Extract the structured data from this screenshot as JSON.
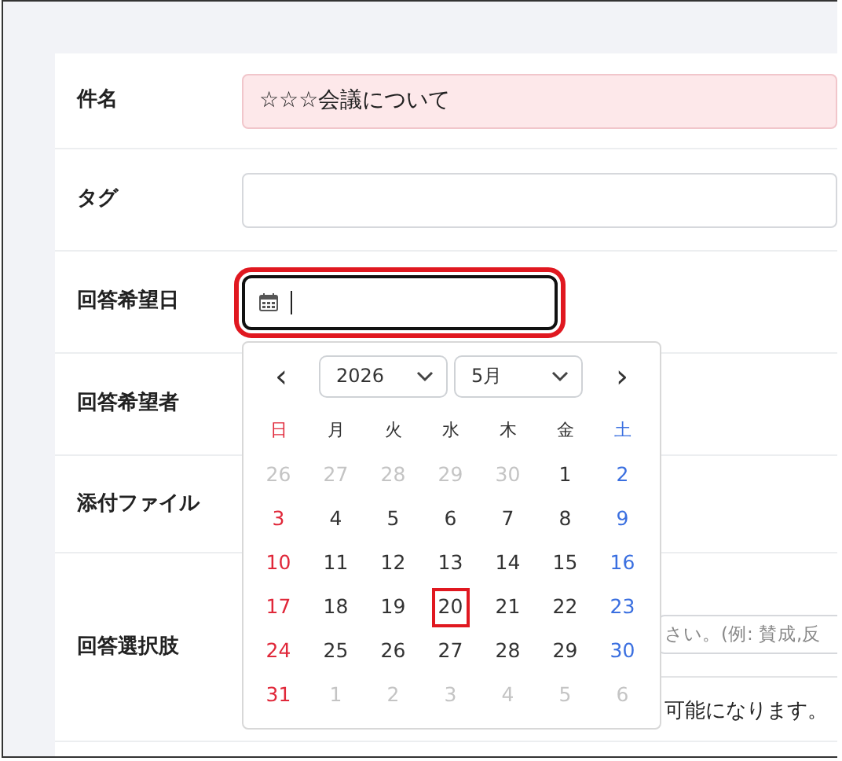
{
  "form": [
    {
      "kind": "text",
      "label": "件名",
      "value": "☆☆☆会議について",
      "invalid": true
    },
    {
      "kind": "text",
      "label": "タグ",
      "invalid": false
    },
    {
      "kind": "date",
      "label": "回答希望日",
      "focused": true,
      "highlighted": true
    },
    {
      "kind": "blank",
      "label": "回答希望者"
    },
    {
      "kind": "blank",
      "label": "添付ファイル"
    },
    {
      "kind": "choices",
      "label": "回答選択肢",
      "placeholder": "さい。(例: 賛成,反",
      "help": "可能になります。"
    }
  ],
  "calendar": {
    "prev": "‹",
    "next": "›",
    "year": "2026",
    "month": "5月",
    "weekdays": [
      {
        "label": "日",
        "kind": "sun"
      },
      {
        "label": "月",
        "kind": "day"
      },
      {
        "label": "火",
        "kind": "day"
      },
      {
        "label": "水",
        "kind": "day"
      },
      {
        "label": "木",
        "kind": "day"
      },
      {
        "label": "金",
        "kind": "day"
      },
      {
        "label": "土",
        "kind": "sat"
      }
    ],
    "weeks": [
      [
        {
          "d": "26",
          "outside": true
        },
        {
          "d": "27",
          "outside": true
        },
        {
          "d": "28",
          "outside": true
        },
        {
          "d": "29",
          "outside": true
        },
        {
          "d": "30",
          "outside": true
        },
        {
          "d": "1",
          "outside": false
        },
        {
          "d": "2",
          "outside": false
        }
      ],
      [
        {
          "d": "3",
          "outside": false
        },
        {
          "d": "4",
          "outside": false
        },
        {
          "d": "5",
          "outside": false
        },
        {
          "d": "6",
          "outside": false
        },
        {
          "d": "7",
          "outside": false
        },
        {
          "d": "8",
          "outside": false
        },
        {
          "d": "9",
          "outside": false
        }
      ],
      [
        {
          "d": "10",
          "outside": false
        },
        {
          "d": "11",
          "outside": false
        },
        {
          "d": "12",
          "outside": false
        },
        {
          "d": "13",
          "outside": false
        },
        {
          "d": "14",
          "outside": false
        },
        {
          "d": "15",
          "outside": false
        },
        {
          "d": "16",
          "outside": false
        }
      ],
      [
        {
          "d": "17",
          "outside": false
        },
        {
          "d": "18",
          "outside": false
        },
        {
          "d": "19",
          "outside": false
        },
        {
          "d": "20",
          "outside": false,
          "highlighted": true
        },
        {
          "d": "21",
          "outside": false
        },
        {
          "d": "22",
          "outside": false
        },
        {
          "d": "23",
          "outside": false
        }
      ],
      [
        {
          "d": "24",
          "outside": false
        },
        {
          "d": "25",
          "outside": false
        },
        {
          "d": "26",
          "outside": false
        },
        {
          "d": "27",
          "outside": false
        },
        {
          "d": "28",
          "outside": false
        },
        {
          "d": "29",
          "outside": false
        },
        {
          "d": "30",
          "outside": false
        }
      ],
      [
        {
          "d": "31",
          "outside": false
        },
        {
          "d": "1",
          "outside": true
        },
        {
          "d": "2",
          "outside": true
        },
        {
          "d": "3",
          "outside": true
        },
        {
          "d": "4",
          "outside": true
        },
        {
          "d": "5",
          "outside": true
        },
        {
          "d": "6",
          "outside": true
        }
      ]
    ]
  }
}
